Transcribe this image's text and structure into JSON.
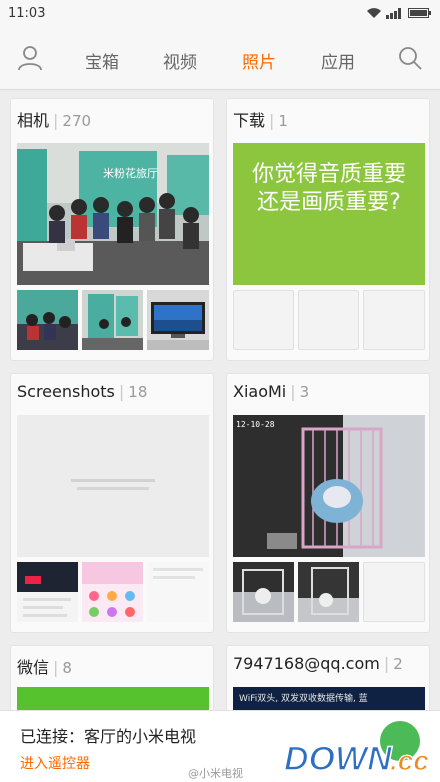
{
  "status_bar": {
    "time": "11:03"
  },
  "tabs": [
    {
      "label": "宝箱",
      "active": false
    },
    {
      "label": "视频",
      "active": false
    },
    {
      "label": "照片",
      "active": true
    },
    {
      "label": "应用",
      "active": false
    }
  ],
  "icons": {
    "profile": "person-icon",
    "search": "search-icon"
  },
  "accent_color": "#ff6a00",
  "albums": [
    {
      "name": "相机",
      "count": "270",
      "banner_text": [
        "米粉花旅厅"
      ]
    },
    {
      "name": "下载",
      "count": "1",
      "cover_text": [
        "你觉得音质重要",
        "还是画质重要?"
      ]
    },
    {
      "name": "Screenshots",
      "count": "18"
    },
    {
      "name": "XiaoMi",
      "count": "3",
      "photo_timestamp": "12-10-28"
    },
    {
      "name": "微信",
      "count": "8"
    },
    {
      "name": "7947168@qq.com",
      "count": "2",
      "cover_text": [
        "WiFi双头, 双发双收数据传输, 蓝"
      ]
    }
  ],
  "bottom_bar": {
    "connected_text": "已连接：客厅的小米电视",
    "remote_link": "进入遥控器"
  },
  "watermark": "@小米电视",
  "logo": {
    "text": "DOWN.cc"
  }
}
